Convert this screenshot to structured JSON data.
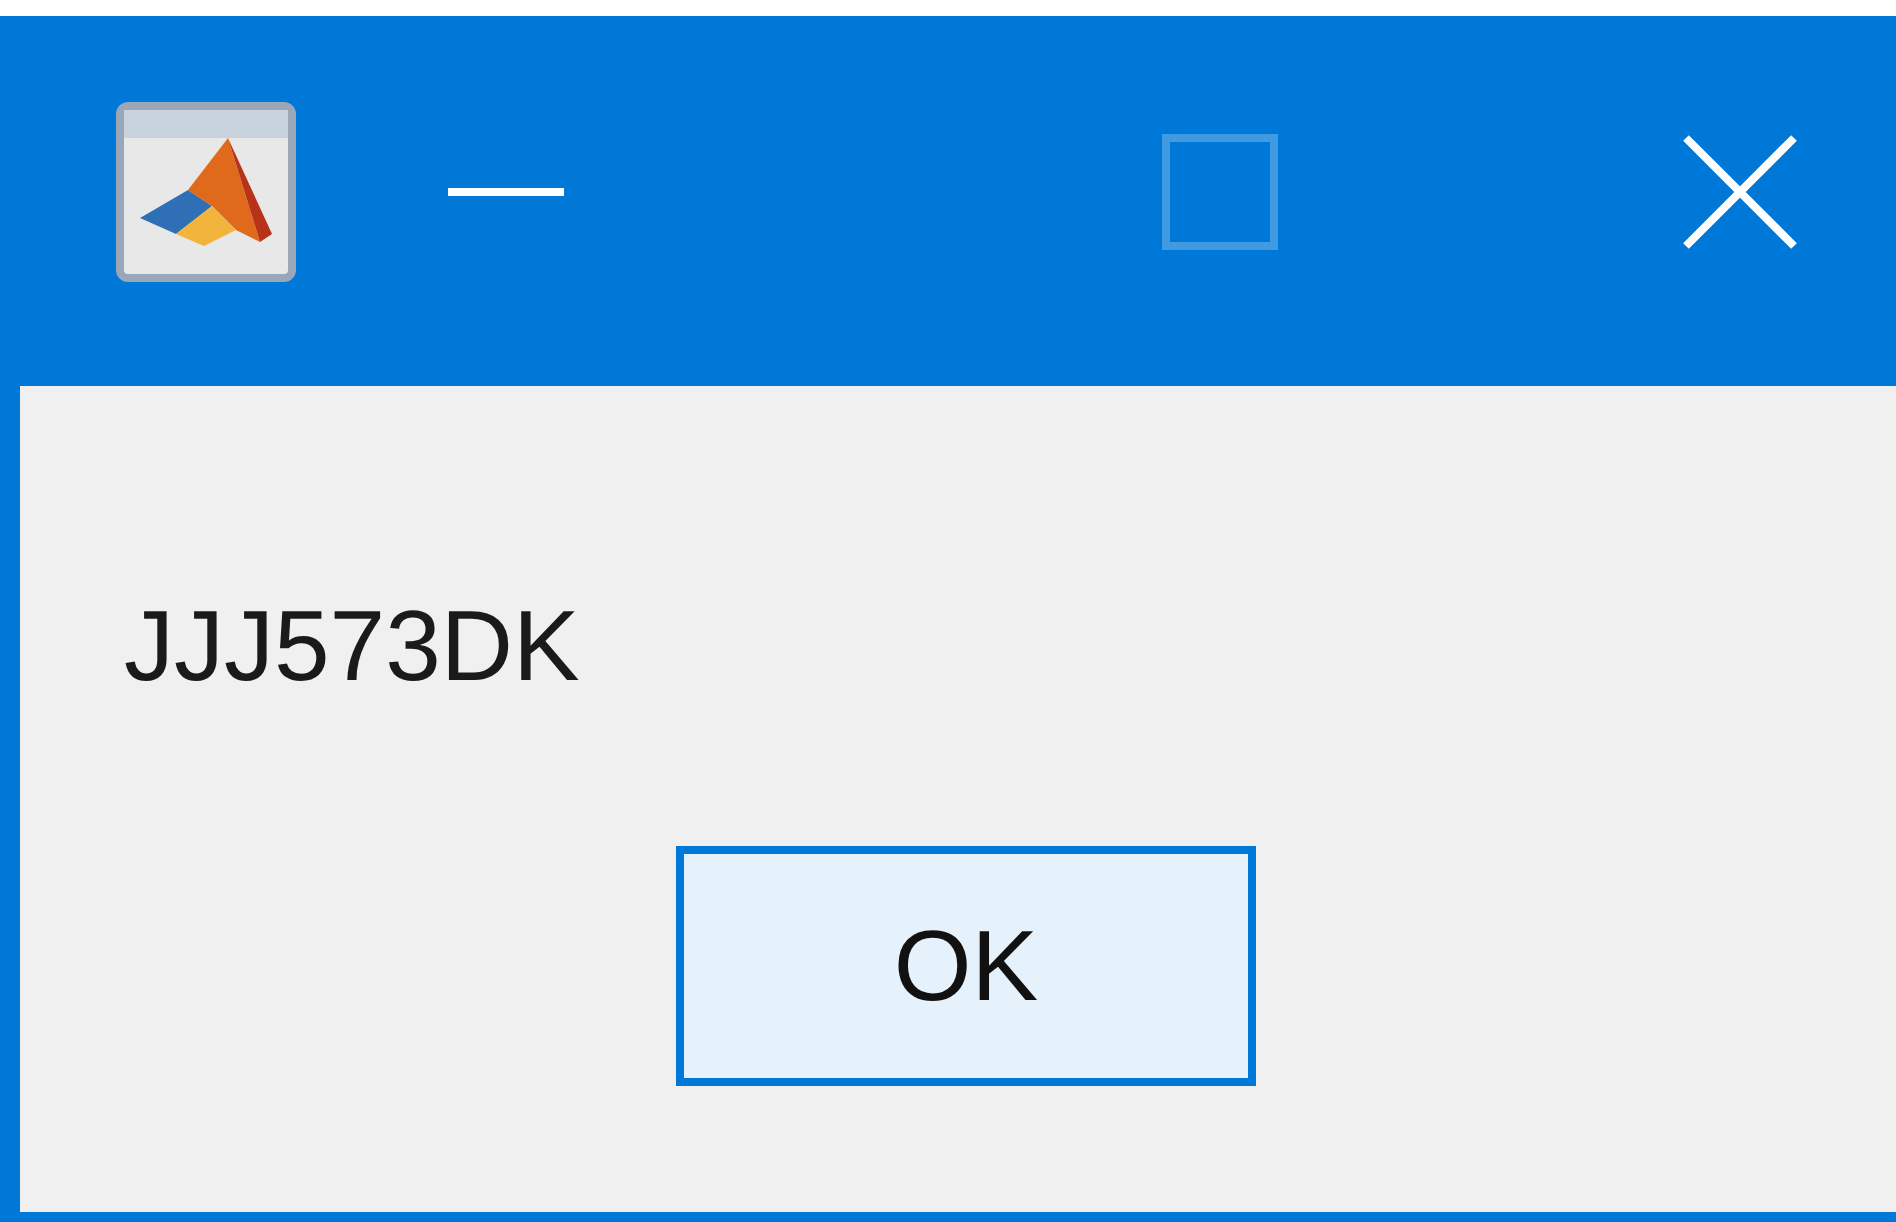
{
  "window": {
    "controls": [
      {
        "kind": "minimize",
        "disabled": false
      },
      {
        "kind": "maximize",
        "disabled": true
      },
      {
        "kind": "close",
        "disabled": false
      }
    ]
  },
  "message": "JJJ573DK",
  "buttons": [
    {
      "label": "OK",
      "focused": true
    }
  ]
}
